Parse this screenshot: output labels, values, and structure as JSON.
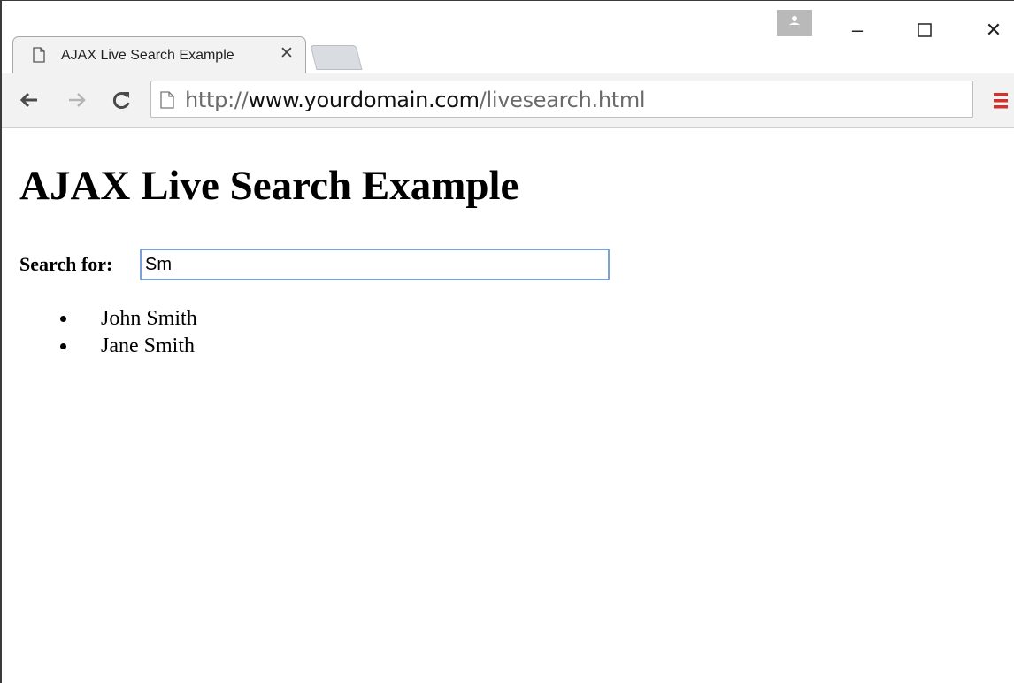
{
  "browser": {
    "tab": {
      "title": "AJAX Live Search Example",
      "close_label": "✕"
    },
    "window_controls": {
      "minimize": "–",
      "maximize": "☐",
      "close": "✕"
    },
    "address_bar": {
      "scheme": "http://",
      "host": "www.yourdomain.com",
      "path": "/livesearch.html"
    },
    "colors": {
      "menu_accent": "#d2322d",
      "input_focus_border": "#7ca0d8"
    }
  },
  "page": {
    "heading": "AJAX Live Search Example",
    "search": {
      "label": "Search for:",
      "value": "Sm"
    },
    "results": [
      "John Smith",
      "Jane Smith"
    ]
  }
}
